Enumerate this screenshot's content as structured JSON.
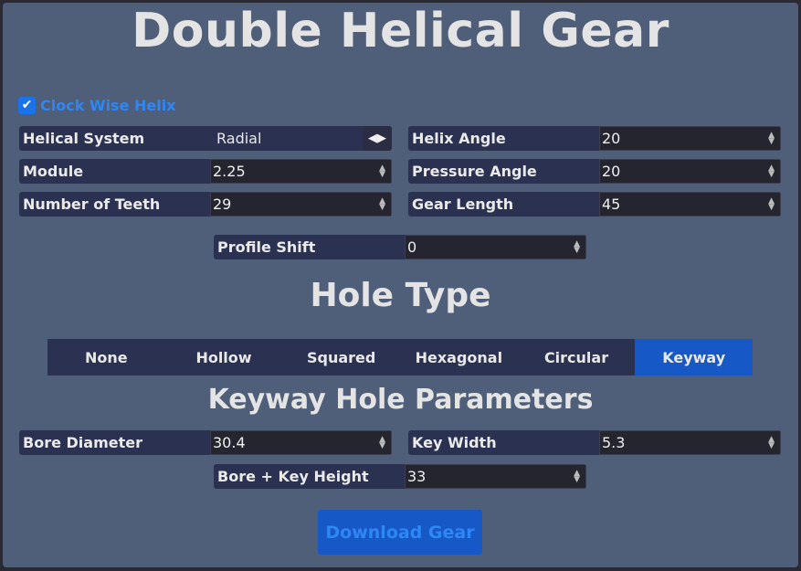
{
  "title": "Double Helical Gear",
  "clockwise_helix": {
    "label": "Clock Wise Helix",
    "checked": true
  },
  "params": {
    "helical_system": {
      "label": "Helical System",
      "value": "Radial"
    },
    "helix_angle": {
      "label": "Helix Angle",
      "value": "20"
    },
    "module": {
      "label": "Module",
      "value": "2.25"
    },
    "pressure_angle": {
      "label": "Pressure Angle",
      "value": "20"
    },
    "number_of_teeth": {
      "label": "Number of Teeth",
      "value": "29"
    },
    "gear_length": {
      "label": "Gear Length",
      "value": "45"
    },
    "profile_shift": {
      "label": "Profile Shift",
      "value": "0"
    }
  },
  "hole_type": {
    "title": "Hole Type",
    "tabs": [
      "None",
      "Hollow",
      "Squared",
      "Hexagonal",
      "Circular",
      "Keyway"
    ],
    "active": "Keyway"
  },
  "keyway": {
    "title": "Keyway Hole Parameters",
    "bore_diameter": {
      "label": "Bore Diameter",
      "value": "30.4"
    },
    "key_width": {
      "label": "Key Width",
      "value": "5.3"
    },
    "bore_key_height": {
      "label": "Bore + Key Height",
      "value": "33"
    }
  },
  "download_label": "Download Gear",
  "colors": {
    "accent": "#1558c6",
    "panel": "#4f5e79",
    "label_bg": "#2b3150",
    "link": "#2f86f5"
  }
}
